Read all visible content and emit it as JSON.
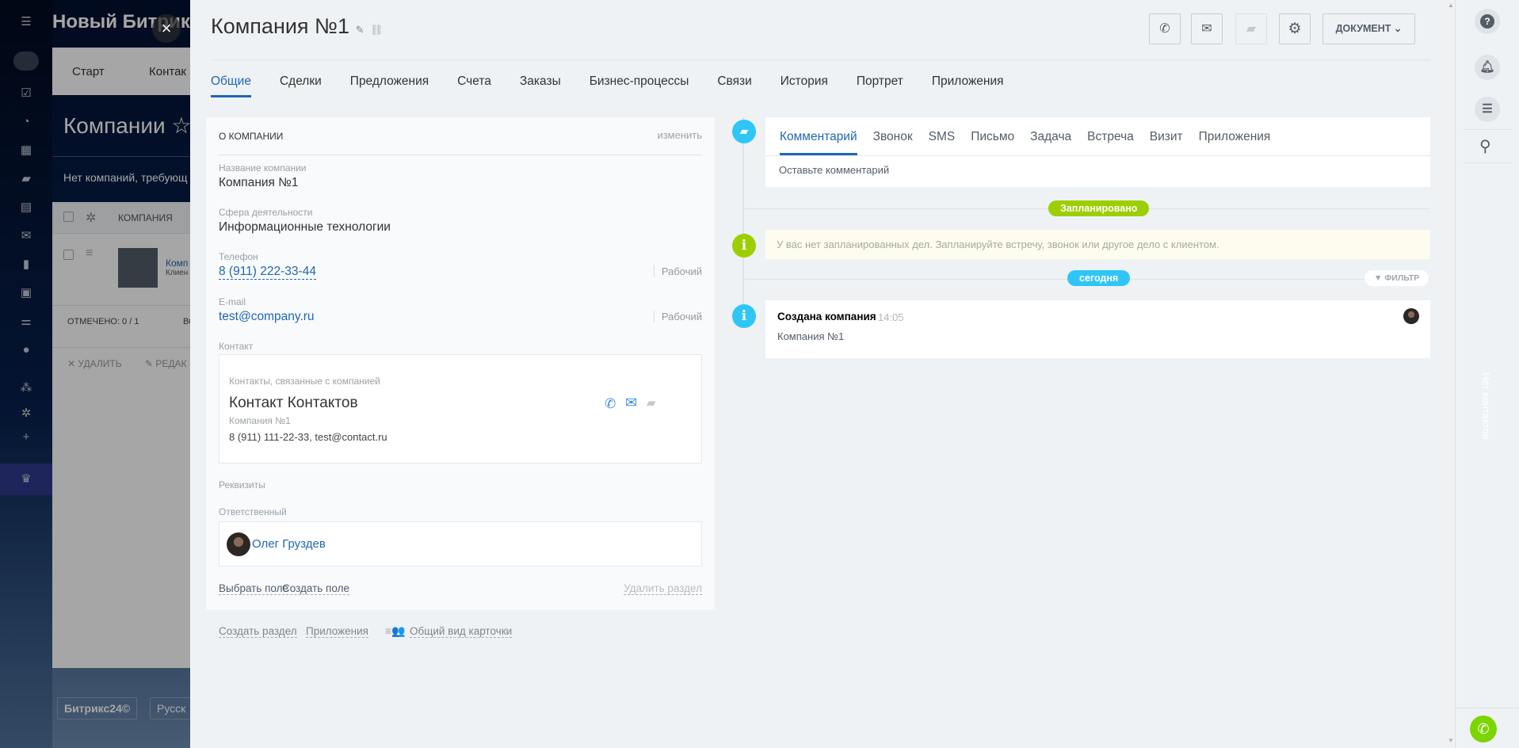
{
  "background_page": {
    "portal_title": "Новый Битрикс",
    "nav_tabs": [
      "Старт",
      "Контак"
    ],
    "page_title": "Компании",
    "notice": "Нет компаний, требующ",
    "table_header": "КОМПАНИЯ",
    "row_name": "Комп",
    "row_sub": "Клиен",
    "footer_marked": "ОТМЕЧЕНО: 0 / 1",
    "footer_all": "ВС",
    "action_delete": "УДАЛИТЬ",
    "action_edit": "РЕДАК",
    "bitrix_button": "Битрикс24©",
    "lang_button": "Русск"
  },
  "header": {
    "title": "Компания №1",
    "document_label": "ДОКУМЕНТ"
  },
  "tabs": [
    {
      "label": "Общие",
      "active": true
    },
    {
      "label": "Сделки"
    },
    {
      "label": "Предложения"
    },
    {
      "label": "Счета"
    },
    {
      "label": "Заказы"
    },
    {
      "label": "Бизнес-процессы"
    },
    {
      "label": "Связи"
    },
    {
      "label": "История"
    },
    {
      "label": "Портрет"
    },
    {
      "label": "Приложения"
    }
  ],
  "about": {
    "section_title": "О КОМПАНИИ",
    "edit_link": "изменить",
    "company_name_label": "Название компании",
    "company_name": "Компания №1",
    "industry_label": "Сфера деятельности",
    "industry": "Информационные технологии",
    "phone_label": "Телефон",
    "phone": "8 (911) 222-33-44",
    "phone_type": "Рабочий",
    "email_label": "E-mail",
    "email": "test@company.ru",
    "email_type": "Рабочий",
    "contact_label": "Контакт",
    "contact_box_caption": "Контакты, связанные с компанией",
    "contact_name": "Контакт Контактов",
    "contact_company": "Компания №1",
    "contact_details": "8 (911) 111-22-33, test@contact.ru",
    "requisites_label": "Реквизиты",
    "responsible_label": "Ответственный",
    "responsible_name": "Олег Груздев",
    "select_field": "Выбрать поле",
    "create_field": "Создать поле",
    "delete_section": "Удалить раздел"
  },
  "bottom_links": {
    "create_section": "Создать раздел",
    "apps": "Приложения",
    "card_view": "Общий вид карточки"
  },
  "timeline": {
    "tabs": [
      {
        "label": "Комментарий",
        "active": true
      },
      {
        "label": "Звонок"
      },
      {
        "label": "SMS"
      },
      {
        "label": "Письмо"
      },
      {
        "label": "Задача"
      },
      {
        "label": "Встреча"
      },
      {
        "label": "Визит"
      },
      {
        "label": "Приложения"
      }
    ],
    "comment_placeholder": "Оставьте комментарий",
    "planned_badge": "Запланировано",
    "planned_empty": "У вас нет запланированных дел. Запланируйте встречу, звонок или другое дело с клиентом.",
    "today_badge": "сегодня",
    "filter": "ФИЛЬТР",
    "event_title": "Создана компания",
    "event_time": "14:05",
    "event_body": "Компания №1"
  },
  "right_bar": {
    "no_contacts": "Нет контактов"
  },
  "colors": {
    "accent": "#2067b0",
    "planned": "#9dcf00",
    "today": "#2fc6f6",
    "call_button": "#7bd500"
  }
}
